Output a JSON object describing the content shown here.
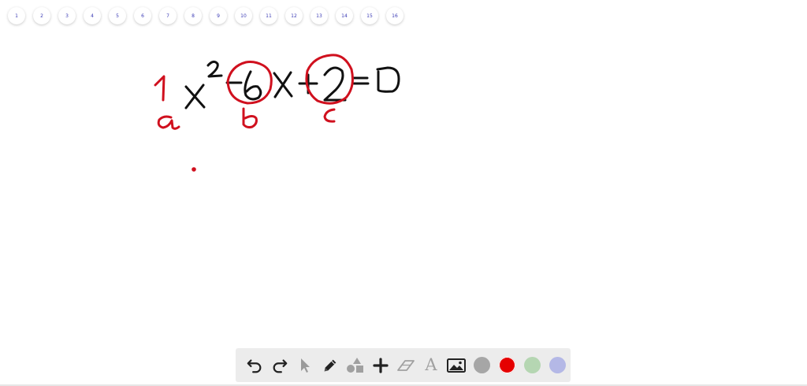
{
  "page_nav": {
    "pages": [
      "1",
      "2",
      "3",
      "4",
      "5",
      "6",
      "7",
      "8",
      "9",
      "10",
      "11",
      "12",
      "13",
      "14",
      "15",
      "16"
    ]
  },
  "whiteboard": {
    "ink_colors": {
      "black": "#111111",
      "red": "#d0101e"
    },
    "content": {
      "equation": "1x² − 6x + 2 = 0",
      "labels": [
        "a",
        "b",
        "c"
      ],
      "circled_terms": [
        "-6",
        "+2"
      ]
    }
  },
  "toolbar": {
    "tools": [
      {
        "name": "undo",
        "icon": "undo-icon"
      },
      {
        "name": "redo",
        "icon": "redo-icon"
      },
      {
        "name": "select",
        "icon": "cursor-icon"
      },
      {
        "name": "pen",
        "icon": "pencil-icon"
      },
      {
        "name": "shapes",
        "icon": "shapes-icon"
      },
      {
        "name": "add",
        "icon": "plus-icon"
      },
      {
        "name": "eraser",
        "icon": "eraser-icon"
      },
      {
        "name": "text",
        "icon": "text-icon",
        "glyph": "A"
      },
      {
        "name": "image",
        "icon": "image-icon"
      }
    ],
    "colors": [
      "#a6a6a6",
      "#e50000",
      "#b5d6b2",
      "#b4b8e6"
    ],
    "selected_color": "#e50000"
  }
}
